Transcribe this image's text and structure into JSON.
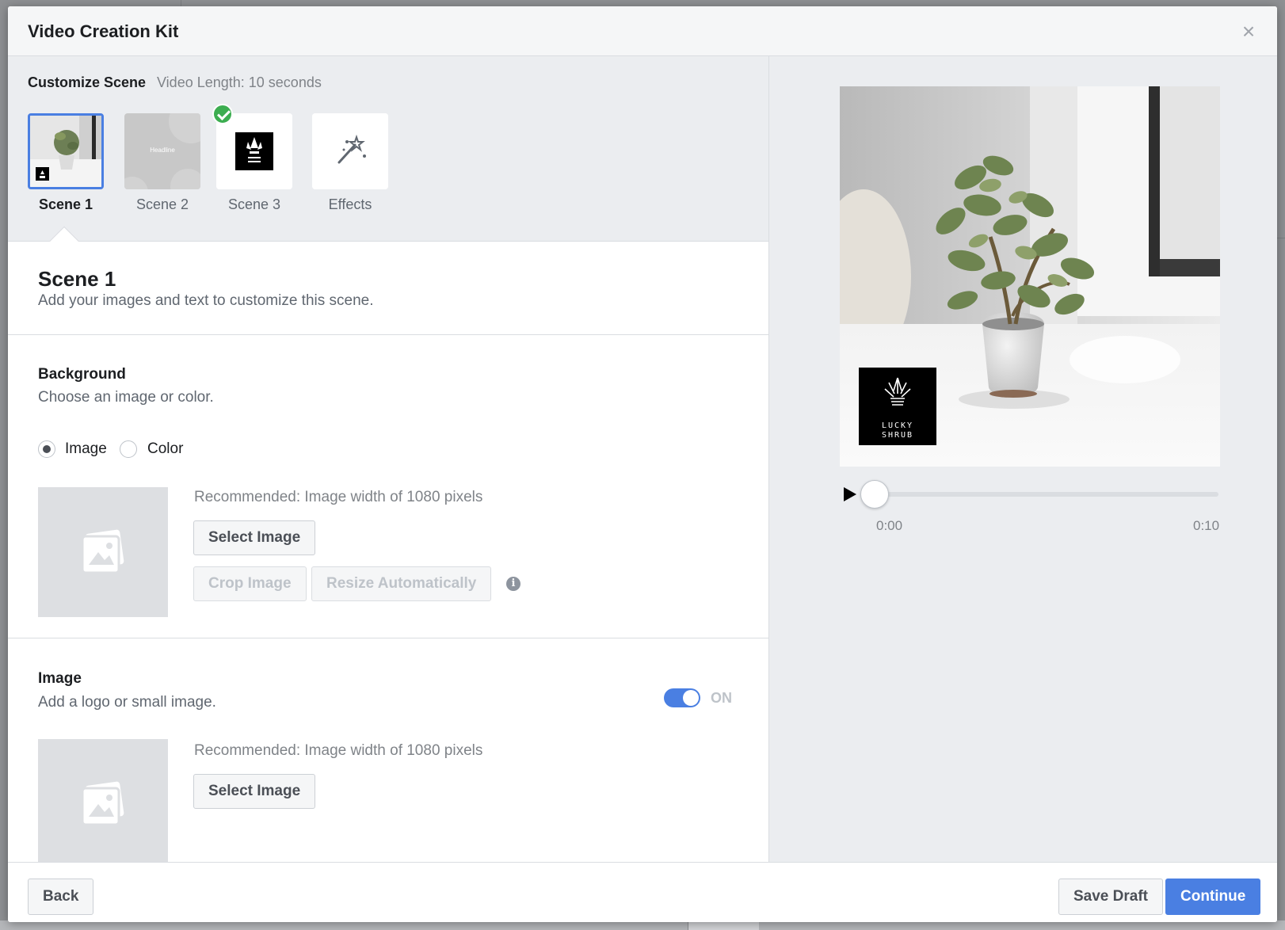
{
  "modal": {
    "title": "Video Creation Kit",
    "close_glyph": "×"
  },
  "strip": {
    "title": "Customize Scene",
    "subtitle": "Video Length: 10 seconds",
    "thumbs": [
      {
        "label": "Scene 1",
        "active": true
      },
      {
        "label": "Scene 2",
        "text": "Headline"
      },
      {
        "label": "Scene 3",
        "completed": true
      },
      {
        "label": "Effects",
        "icon": "magic-wand-icon"
      }
    ]
  },
  "scene": {
    "title": "Scene 1",
    "description": "Add your images and text to customize this scene."
  },
  "background": {
    "title": "Background",
    "description": "Choose an image or color.",
    "options": [
      {
        "label": "Image",
        "checked": true
      },
      {
        "label": "Color",
        "checked": false
      }
    ],
    "recommended": "Recommended: Image width of 1080 pixels",
    "select_label": "Select Image",
    "crop_label": "Crop Image",
    "resize_label": "Resize Automatically",
    "info_glyph": "i"
  },
  "image": {
    "title": "Image",
    "description": "Add a logo or small image.",
    "toggle_label": "ON",
    "recommended": "Recommended: Image width of 1080 pixels",
    "select_label": "Select Image"
  },
  "preview": {
    "logo_text_1": "LUCKY",
    "logo_text_2": "SHRUB",
    "time_start": "0:00",
    "time_end": "0:10",
    "progress_fraction": 0
  },
  "footer": {
    "back_label": "Back",
    "save_label": "Save Draft",
    "continue_label": "Continue"
  },
  "colors": {
    "accent": "#4a7fe2",
    "success": "#3cad50"
  }
}
